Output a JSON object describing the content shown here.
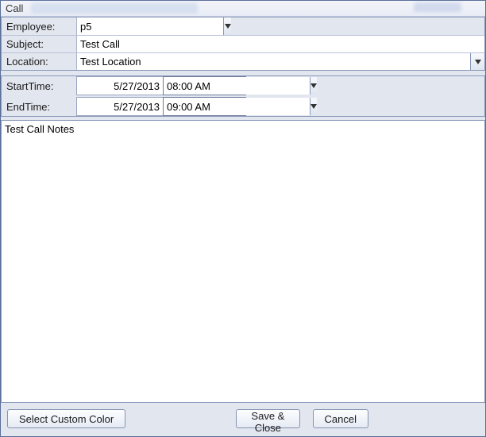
{
  "window": {
    "title": "Call"
  },
  "labels": {
    "employee": "Employee:",
    "subject": "Subject:",
    "location": "Location:",
    "starttime": "StartTime:",
    "endtime": "EndTime:"
  },
  "fields": {
    "employee": "p5",
    "subject": "Test Call",
    "location": "Test Location",
    "start_date": "5/27/2013",
    "start_time": "08:00 AM",
    "end_date": "5/27/2013",
    "end_time": "09:00 AM",
    "notes": "Test Call Notes"
  },
  "buttons": {
    "select_color": "Select Custom Color",
    "save_close": "Save & Close",
    "cancel": "Cancel"
  }
}
